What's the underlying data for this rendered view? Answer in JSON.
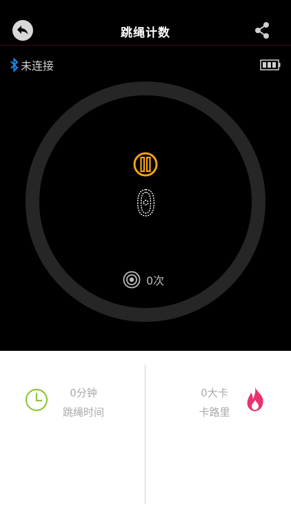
{
  "header": {
    "title": "跳绳计数",
    "back_icon": "back-arrow-icon",
    "share_icon": "share-icon"
  },
  "connection": {
    "icon": "bluetooth-icon",
    "status_label": "未连接"
  },
  "battery": {
    "icon": "battery-icon"
  },
  "counter": {
    "count": "0",
    "pause_icon": "pause-icon",
    "target_icon": "target-icon",
    "target_label": "0次"
  },
  "stats": {
    "time": {
      "value": "0分钟",
      "label": "跳绳时间",
      "icon": "clock-icon"
    },
    "calories": {
      "value": "0大卡",
      "label": "卡路里",
      "icon": "flame-icon"
    }
  },
  "colors": {
    "background_dark": "#000000",
    "accent_orange": "#f5a21b",
    "ring": "#262626",
    "clock_green": "#8cc63f",
    "flame_pink": "#e8336d",
    "bluetooth_blue": "#1e88e5"
  }
}
